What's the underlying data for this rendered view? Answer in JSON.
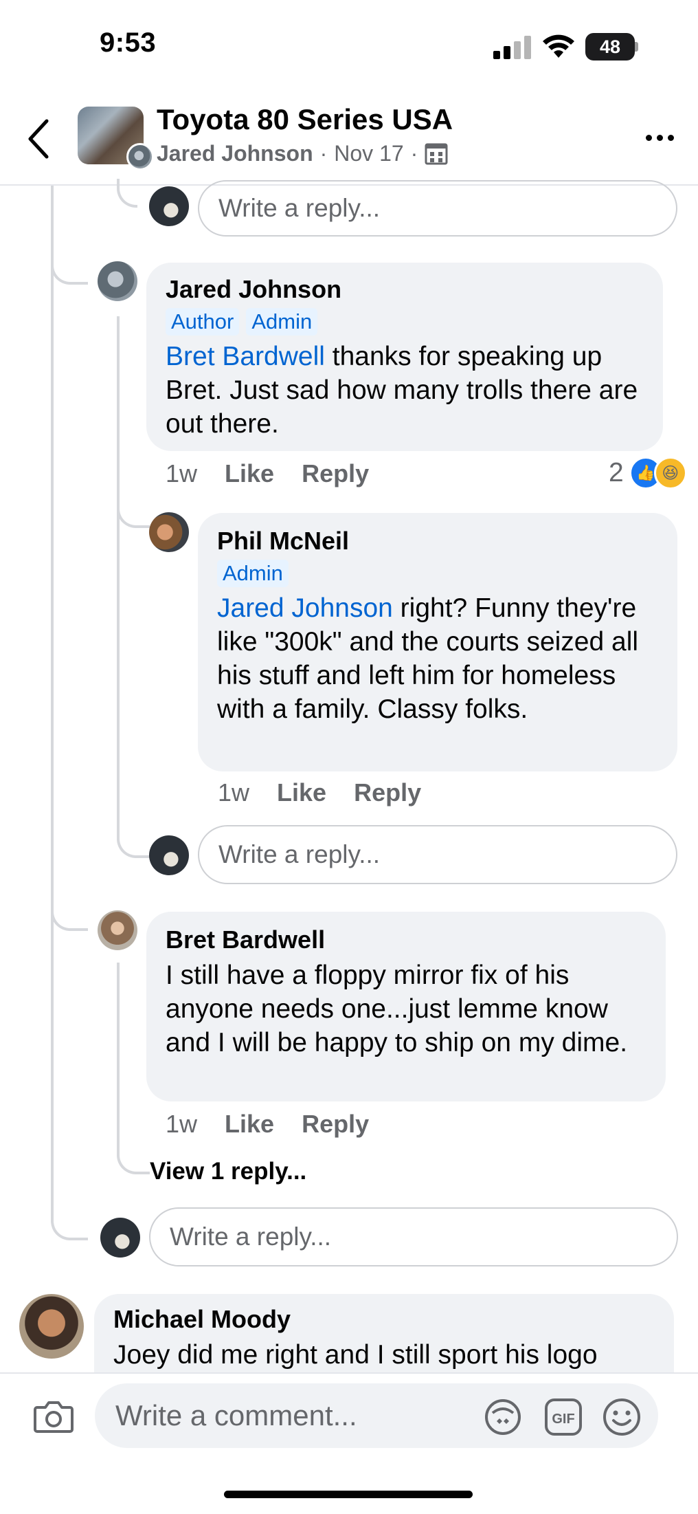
{
  "status_bar": {
    "time": "9:53",
    "battery": "48"
  },
  "header": {
    "group_name": "Toyota 80 Series USA",
    "author": "Jared Johnson",
    "separator": "·",
    "date": "Nov 17"
  },
  "reply_placeholder": "Write a reply...",
  "comments": [
    {
      "name": "Jared Johnson",
      "badges": [
        "Author",
        "Admin"
      ],
      "mention": "Bret Bardwell",
      "text": " thanks for speaking up Bret. Just sad how many trolls there are out there.",
      "time": "1w",
      "like": "Like",
      "reply": "Reply",
      "reaction_count": "2"
    },
    {
      "name": "Phil McNeil",
      "badges": [
        "Admin"
      ],
      "mention": "Jared Johnson",
      "text": " right? Funny they're like \"300k\" and the courts seized all his stuff and left him for homeless with a family. Classy folks.",
      "time": "1w",
      "like": "Like",
      "reply": "Reply"
    },
    {
      "name": "Bret Bardwell",
      "text": "I still have a floppy mirror fix of his anyone needs one...just lemme know and I will be happy to ship on my dime.",
      "time": "1w",
      "like": "Like",
      "reply": "Reply",
      "view_replies": "View 1 reply..."
    },
    {
      "name": "Michael Moody",
      "text": "Joey did me right and I still sport his logo"
    }
  ],
  "composer": {
    "placeholder": "Write a comment...",
    "gif_label": "GIF"
  }
}
